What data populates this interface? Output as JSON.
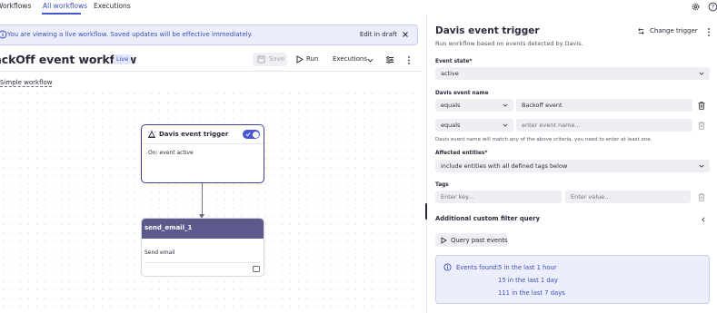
{
  "nav": {
    "tabs": [
      {
        "label": "Workflows"
      },
      {
        "label": "All workflows"
      },
      {
        "label": "Executions"
      }
    ],
    "icons": [
      "gear-icon",
      "help-icon"
    ]
  },
  "banner": {
    "text": "You are viewing a live workflow. Saved updates will be effective immediately.",
    "edit_label": "Edit in draft"
  },
  "workflow": {
    "title": "BackOff event workflow",
    "status": "Live",
    "save_label": "Save",
    "run_label": "Run",
    "executions_label": "Executions",
    "subtitle_link": "Simple workflow"
  },
  "canvas": {
    "trigger_node": {
      "title": "Davis event trigger",
      "body": "On: event active",
      "enabled": true
    },
    "action_node": {
      "title": "send_email_1",
      "body": "Send email"
    }
  },
  "panel": {
    "title": "Davis event trigger",
    "subtitle": "Run workflow based on events detected by Davis.",
    "change_trigger_label": "Change trigger",
    "event_state": {
      "label": "Event state*",
      "value": "active"
    },
    "event_name": {
      "label": "Davis event name",
      "rows": [
        {
          "operator": "equals",
          "value": "Backoff event",
          "placeholder": ""
        },
        {
          "operator": "equals",
          "value": "",
          "placeholder": "enter event name..."
        }
      ],
      "hint": "Davis event name will match any of the above criteria, you need to enter at least one."
    },
    "affected_entities": {
      "label": "Affected entities*",
      "value": "include entities with all defined tags below"
    },
    "tags": {
      "label": "Tags",
      "key_placeholder": "Enter key...",
      "value_placeholder": "Enter value..."
    },
    "additional_filter_label": "Additional custom filter query",
    "query_button_label": "Query past events",
    "events_found": {
      "label": "Events found:",
      "lines": [
        "5 in the last 1 hour",
        "15 in the last 1 day",
        "111 in the last 7 days"
      ]
    }
  },
  "colors": {
    "accent": "#4556d6",
    "accent_text": "#3c4dbb",
    "node_header": "#5c5a8c",
    "info_bg": "#edeefb"
  }
}
